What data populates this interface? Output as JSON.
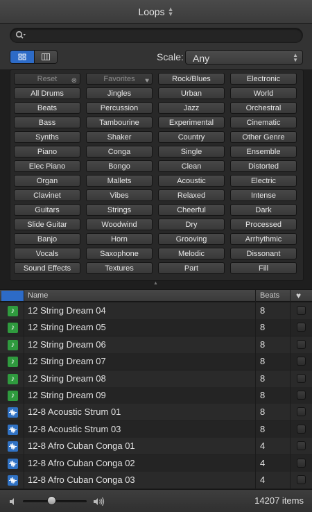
{
  "header": {
    "title": "Loops"
  },
  "search": {
    "value": "",
    "placeholder": ""
  },
  "view_toggle": {
    "selected": "button-view"
  },
  "scale": {
    "label": "Scale:",
    "value": "Any"
  },
  "keywords": {
    "columns": [
      [
        "Reset",
        "All Drums",
        "Beats",
        "Bass",
        "Synths",
        "Piano",
        "Elec Piano",
        "Organ",
        "Clavinet",
        "Guitars",
        "Slide Guitar",
        "Banjo",
        "Vocals",
        "Sound Effects"
      ],
      [
        "Favorites",
        "Jingles",
        "Percussion",
        "Tambourine",
        "Shaker",
        "Conga",
        "Bongo",
        "Mallets",
        "Vibes",
        "Strings",
        "Woodwind",
        "Horn",
        "Saxophone",
        "Textures"
      ],
      [
        "Rock/Blues",
        "Urban",
        "Jazz",
        "Experimental",
        "Country",
        "Single",
        "Clean",
        "Acoustic",
        "Relaxed",
        "Cheerful",
        "Dry",
        "Grooving",
        "Melodic",
        "Part"
      ],
      [
        "Electronic",
        "World",
        "Orchestral",
        "Cinematic",
        "Other Genre",
        "Ensemble",
        "Distorted",
        "Electric",
        "Intense",
        "Dark",
        "Processed",
        "Arrhythmic",
        "Dissonant",
        "Fill"
      ]
    ]
  },
  "table": {
    "columns": {
      "name": "Name",
      "beats": "Beats",
      "fav": "♥"
    },
    "rows": [
      {
        "type": "midi",
        "name": "12 String Dream 04",
        "beats": "8"
      },
      {
        "type": "midi",
        "name": "12 String Dream 05",
        "beats": "8"
      },
      {
        "type": "midi",
        "name": "12 String Dream 06",
        "beats": "8"
      },
      {
        "type": "midi",
        "name": "12 String Dream 07",
        "beats": "8"
      },
      {
        "type": "midi",
        "name": "12 String Dream 08",
        "beats": "8"
      },
      {
        "type": "midi",
        "name": "12 String Dream 09",
        "beats": "8"
      },
      {
        "type": "audio",
        "name": "12-8 Acoustic Strum 01",
        "beats": "8"
      },
      {
        "type": "audio",
        "name": "12-8 Acoustic Strum 03",
        "beats": "8"
      },
      {
        "type": "audio",
        "name": "12-8 Afro Cuban Conga 01",
        "beats": "4"
      },
      {
        "type": "audio",
        "name": "12-8 Afro Cuban Conga 02",
        "beats": "4"
      },
      {
        "type": "audio",
        "name": "12-8 Afro Cuban Conga 03",
        "beats": "4"
      }
    ]
  },
  "footer": {
    "item_count": "14207 items",
    "volume": 0.45
  },
  "colors": {
    "accent": "#2d6bc7",
    "midi_icon": "#2f9a3e",
    "audio_icon": "#3072c4"
  }
}
